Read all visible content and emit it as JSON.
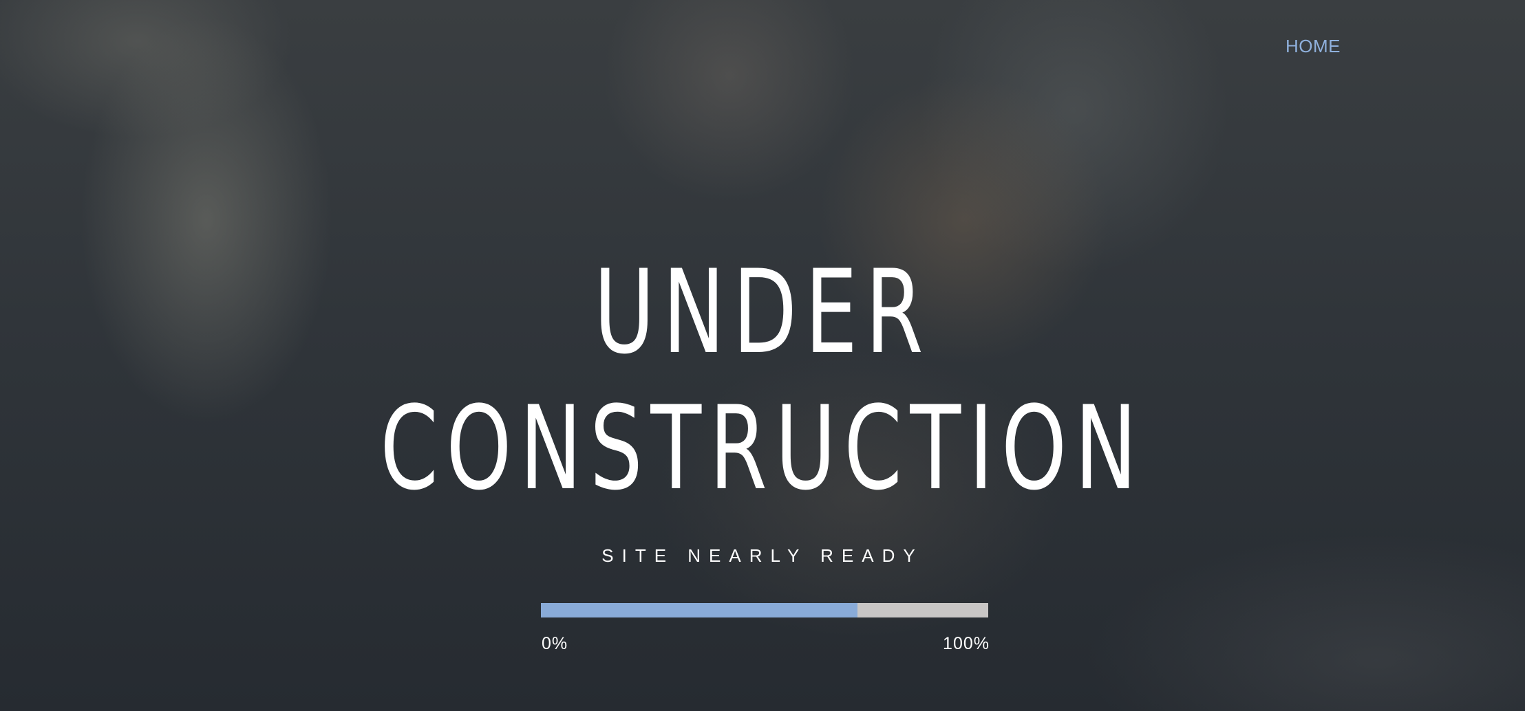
{
  "nav": {
    "home_label": "HOME"
  },
  "hero": {
    "title_line1": "UNDER",
    "title_line2": "CONSTRUCTION",
    "subtitle": "SITE NEARLY READY"
  },
  "progress": {
    "fraction": 0.708,
    "min_label": "0%",
    "max_label": "100%"
  },
  "colors": {
    "accent": "#89abd8",
    "nav_link": "#8fb0dc",
    "track": "#c8c6c5",
    "text": "#ffffff"
  }
}
